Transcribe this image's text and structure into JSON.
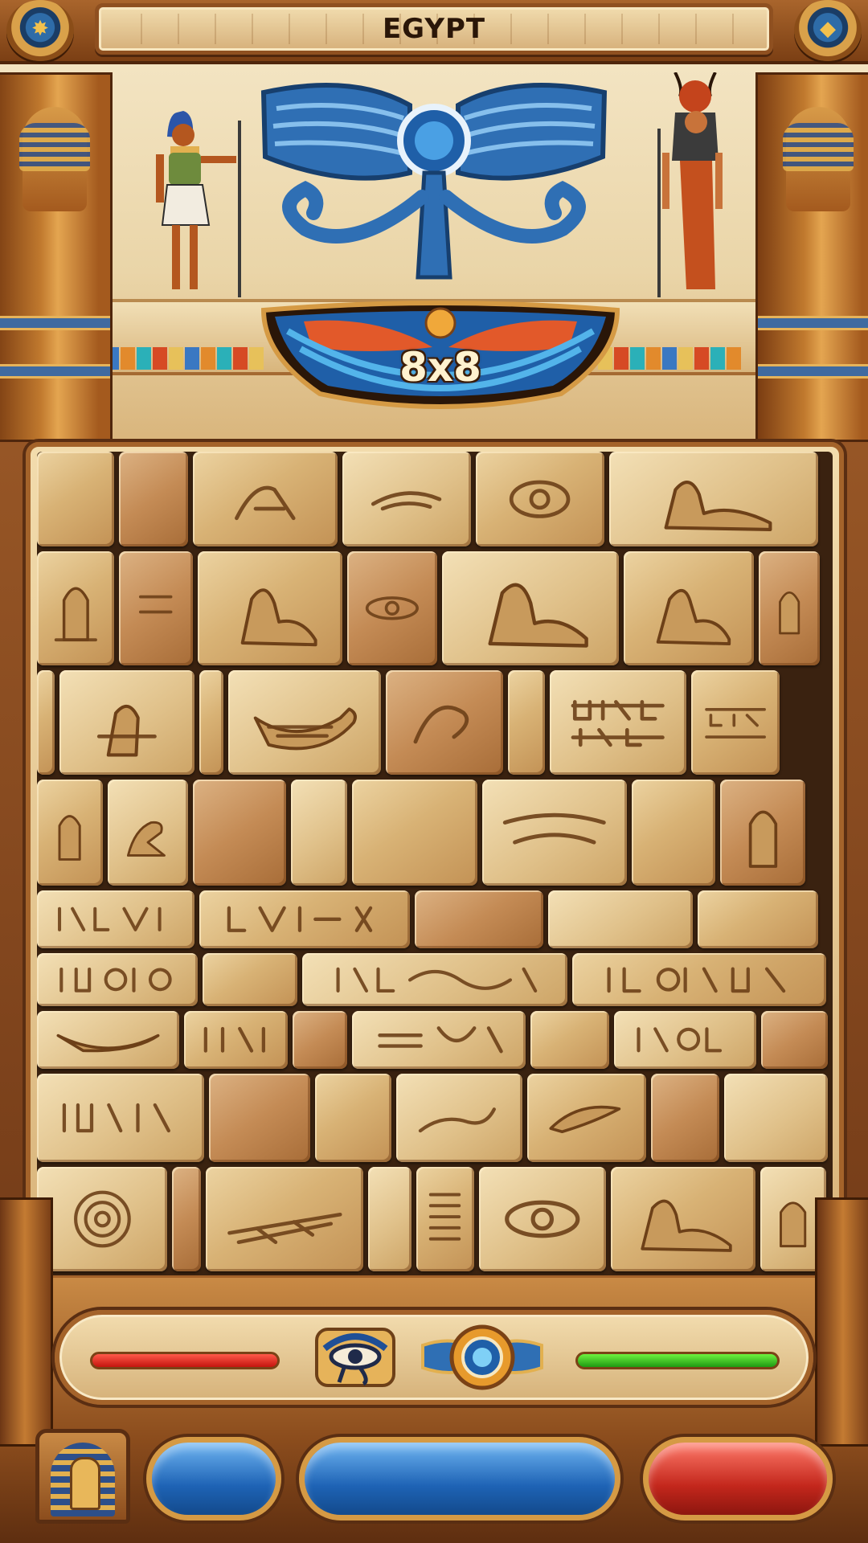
{
  "header": {
    "title": "EGYPT",
    "left_button_icon": "sun-burst-icon",
    "right_button_icon": "gem-icon"
  },
  "level": {
    "size_label": "8x8"
  },
  "status": {
    "left_bar_color": "#d9231a",
    "right_bar_color": "#2db51d",
    "left_icon": "eye-of-horus-icon",
    "right_icon": "winged-orb-icon"
  },
  "controls": {
    "tile_button_icon": "pharaoh-headdress-icon",
    "buttons": [
      "blue-small",
      "blue-large",
      "red"
    ]
  },
  "colors": {
    "accent_blue": "#1e63b5",
    "accent_gold": "#d59a44",
    "accent_red": "#c3271c",
    "stone": "#d8b275"
  }
}
